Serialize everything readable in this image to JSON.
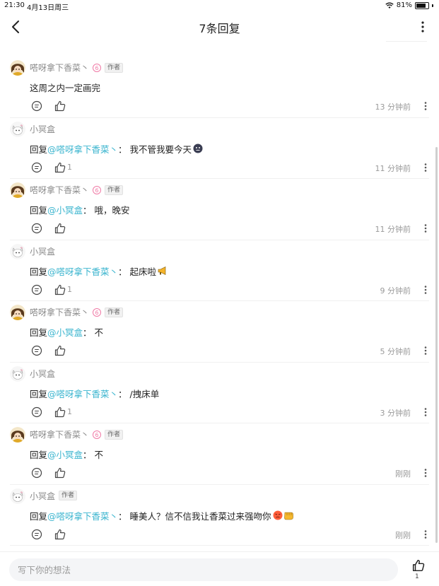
{
  "status_bar": {
    "time": "21:30",
    "date": "4月13日周三",
    "battery": "81%",
    "battery_level": 0.81
  },
  "header": {
    "title": "7条回复"
  },
  "comments": [
    {
      "user": "嗒呀拿下香菜丶",
      "avatar": "girl-brown",
      "is_author": true,
      "level_badge": "6",
      "author_badge": "作者",
      "prefix": "",
      "mention": "",
      "separator": "",
      "text": "这周之内一定画完",
      "emoji": "",
      "likes": "",
      "time": "13 分钟前"
    },
    {
      "user": "小冥盒",
      "avatar": "cat-white",
      "is_author": false,
      "level_badge": "",
      "author_badge": "",
      "prefix": "回复",
      "mention": "@嗒呀拿下香菜丶",
      "separator": "：",
      "text": "我不管我要今天",
      "emoji": "dark-face",
      "likes": "1",
      "time": "11 分钟前"
    },
    {
      "user": "嗒呀拿下香菜丶",
      "avatar": "girl-brown",
      "is_author": true,
      "level_badge": "6",
      "author_badge": "作者",
      "prefix": "回复",
      "mention": "@小冥盒",
      "separator": "：",
      "text": "哦，晚安",
      "emoji": "",
      "likes": "",
      "time": "11 分钟前"
    },
    {
      "user": "小冥盒",
      "avatar": "cat-white",
      "is_author": false,
      "level_badge": "",
      "author_badge": "",
      "prefix": "回复",
      "mention": "@嗒呀拿下香菜丶",
      "separator": "：",
      "text": "起床啦",
      "emoji": "megaphone",
      "likes": "1",
      "time": "9 分钟前"
    },
    {
      "user": "嗒呀拿下香菜丶",
      "avatar": "girl-brown",
      "is_author": true,
      "level_badge": "6",
      "author_badge": "作者",
      "prefix": "回复",
      "mention": "@小冥盒",
      "separator": "：",
      "text": "不",
      "emoji": "",
      "likes": "",
      "time": "5 分钟前"
    },
    {
      "user": "小冥盒",
      "avatar": "cat-white",
      "is_author": false,
      "level_badge": "",
      "author_badge": "",
      "prefix": "回复",
      "mention": "@嗒呀拿下香菜丶",
      "separator": "：",
      "text": "/拽床单",
      "emoji": "",
      "likes": "1",
      "time": "3 分钟前"
    },
    {
      "user": "嗒呀拿下香菜丶",
      "avatar": "girl-brown",
      "is_author": true,
      "level_badge": "6",
      "author_badge": "作者",
      "prefix": "回复",
      "mention": "@小冥盒",
      "separator": "：",
      "text": "不",
      "emoji": "",
      "likes": "",
      "time": "刚刚"
    },
    {
      "user": "小冥盒",
      "avatar": "cat-white",
      "is_author": false,
      "level_badge": "",
      "author_badge": "作者",
      "prefix": "回复",
      "mention": "@嗒呀拿下香菜丶",
      "separator": "：",
      "text": "睡美人？信不信我让香菜过来强吻你",
      "emoji": "angry-fist",
      "likes": "",
      "time": "刚刚"
    }
  ],
  "bottom_bar": {
    "placeholder": "写下你的想法",
    "like_count": "1"
  },
  "colors": {
    "mention": "#3bb5cf",
    "level_badge": "#f07aa6",
    "meta_text": "#9a9a9a"
  }
}
